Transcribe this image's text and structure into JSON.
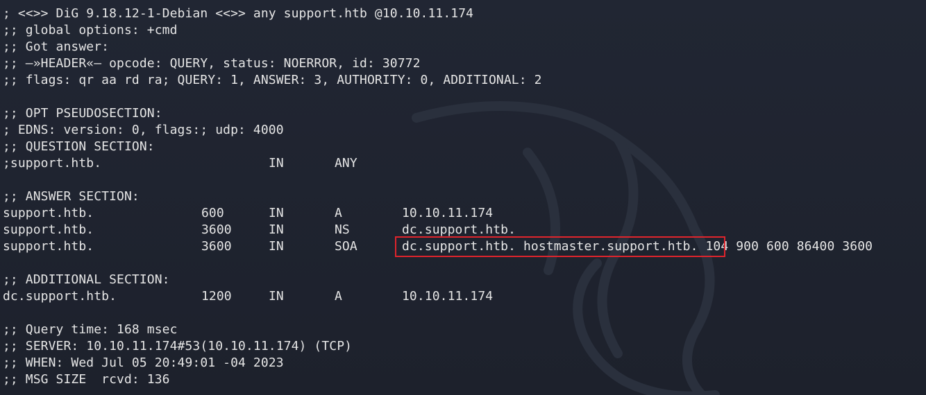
{
  "header": {
    "command": "; <<>> DiG 9.18.12-1-Debian <<>> any support.htb @10.10.11.174",
    "global_options": ";; global options: +cmd",
    "got_answer": ";; Got answer:",
    "header_line": ";; —»HEADER«— opcode: QUERY, status: NOERROR, id: 30772",
    "flags_line": ";; flags: qr aa rd ra; QUERY: 1, ANSWER: 3, AUTHORITY: 0, ADDITIONAL: 2"
  },
  "opt": {
    "title": ";; OPT PSEUDOSECTION:",
    "edns": "; EDNS: version: 0, flags:; udp: 4000"
  },
  "question": {
    "title": ";; QUESTION SECTION:",
    "name": ";support.htb.",
    "class": "IN",
    "type": "ANY"
  },
  "answer": {
    "title": ";; ANSWER SECTION:",
    "records": [
      {
        "name": "support.htb.",
        "ttl": "600",
        "class": "IN",
        "type": "A",
        "data": "10.10.11.174"
      },
      {
        "name": "support.htb.",
        "ttl": "3600",
        "class": "IN",
        "type": "NS",
        "data": "dc.support.htb."
      },
      {
        "name": "support.htb.",
        "ttl": "3600",
        "class": "IN",
        "type": "SOA",
        "data": "dc.support.htb. hostmaster.support.htb. 104 900 600 86400 3600"
      }
    ]
  },
  "additional": {
    "title": ";; ADDITIONAL SECTION:",
    "records": [
      {
        "name": "dc.support.htb.",
        "ttl": "1200",
        "class": "IN",
        "type": "A",
        "data": "10.10.11.174"
      }
    ]
  },
  "footer": {
    "query_time": ";; Query time: 168 msec",
    "server": ";; SERVER: 10.10.11.174#53(10.10.11.174) (TCP)",
    "when": ";; WHEN: Wed Jul 05 20:49:01 -04 2023",
    "msg_size": ";; MSG SIZE  rcvd: 136"
  },
  "colors": {
    "background": "#1f2430",
    "text": "#e6e6e6",
    "highlight_border": "#e0242c"
  },
  "icons": {
    "watermark": "kali-dragon-icon"
  }
}
